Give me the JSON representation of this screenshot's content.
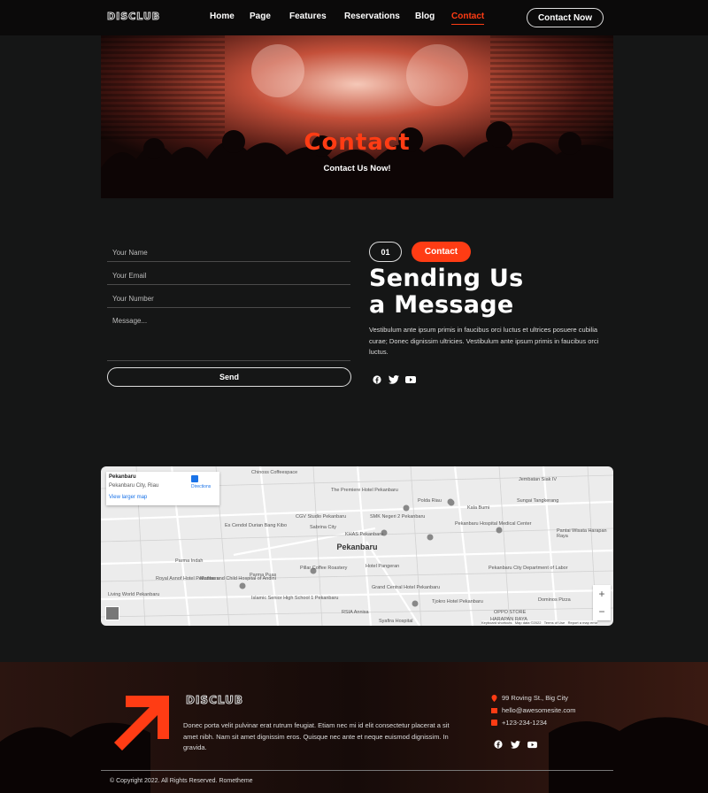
{
  "nav": {
    "logo": "DISCLUB",
    "links": [
      "Home",
      "Page",
      "Features",
      "Reservations",
      "Blog",
      "Contact"
    ],
    "active": "Contact",
    "cta": "Contact Now"
  },
  "hero": {
    "title": "Contact",
    "subtitle": "Contact Us Now!"
  },
  "form": {
    "name_placeholder": "Your Name",
    "email_placeholder": "Your Email",
    "number_placeholder": "Your Number",
    "message_placeholder": "Message...",
    "send_label": "Send"
  },
  "intro": {
    "badge_number": "01",
    "badge_label": "Contact",
    "heading_line1": "Sending Us",
    "heading_line2": "a Message",
    "paragraph": "Vestibulum ante ipsum primis in faucibus orci luctus et ultrices posuere cubilia curae; Donec dignissim ultricies. Vestibulum ante ipsum primis in faucibus orci luctus.",
    "socials": [
      "facebook-icon",
      "twitter-icon",
      "youtube-icon"
    ]
  },
  "map": {
    "card_title": "Pekanbaru",
    "card_subtitle": "Pekanbaru City, Riau",
    "card_link": "View larger map",
    "directions": "Directions",
    "center_label": "Pekanbaru",
    "labels": [
      "Chinoss Coffeespace",
      "The Premiere Hotel Pekanbaru",
      "Polda Riau",
      "Jembatan Siak IV",
      "Kala Bumi",
      "Sungai Tangkerang",
      "CGV Studio Pekanbaru",
      "SMK Negeri 2 Pekanbaru",
      "Sabrina City",
      "KHAS Pekanbaru",
      "Pekanbaru Hospital Medical Center",
      "Pantai Wisata Harapan Raya",
      "Es Cendol Durian Bang Kibo",
      "Parma Indah",
      "Pillar Coffee Roastery",
      "Hotel Pangeran",
      "Pekanbaru City Department of Labor",
      "Royal Asnof Hotel Pekanbaru",
      "Mother and Child Hospital of Andini",
      "Parma Puas",
      "Living World Pekanbaru",
      "Islamic Senior High School 1 Pekanbaru",
      "Grand Central Hotel Pekanbaru",
      "Tjokro Hotel Pekanbaru",
      "RSIA Annisa",
      "Syafira Hospital",
      "Dominos Pizza",
      "OPPO STORE",
      "HARAPAN RAYA"
    ],
    "attribution": [
      "Keyboard shortcuts",
      "Map data ©2022",
      "Terms of Use",
      "Report a map error"
    ],
    "zoom_in": "+",
    "zoom_out": "−"
  },
  "footer": {
    "logo": "DISCLUB",
    "description": "Donec porta velit pulvinar erat rutrum feugiat. Etiam nec mi id elit consectetur placerat a sit amet nibh. Nam sit amet dignissim eros. Quisque nec ante et neque euismod dignissim. In gravida.",
    "address": "99 Roving St., Big City",
    "email": "hello@awesomesite.com",
    "phone": "+123-234-1234",
    "copyright": "© Copyright 2022. All Rights Reserved. Rometheme"
  },
  "colors": {
    "accent": "#ff3c14",
    "bg": "#151616",
    "nav_bg": "#0b0a0a"
  }
}
